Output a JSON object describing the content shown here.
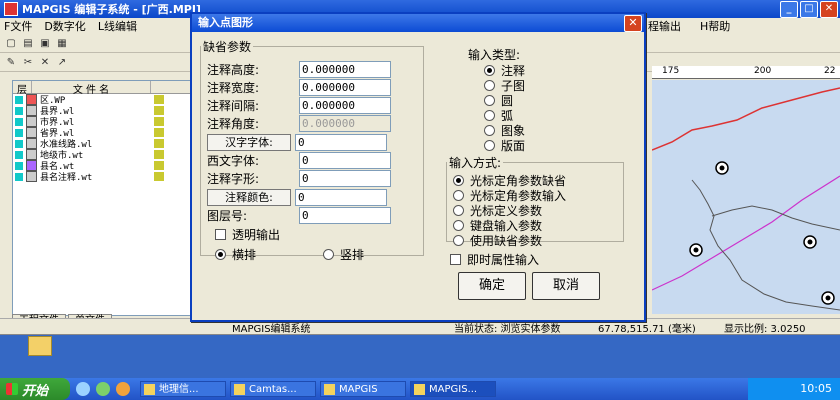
{
  "app": {
    "title": "MAPGIS 编辑子系统 - [广西.MPJ]",
    "menu": [
      "F文件",
      "D数字化",
      "L线编辑"
    ],
    "menu_right": [
      "程输出",
      "H帮助"
    ],
    "ruler": [
      "175",
      "200",
      "22"
    ],
    "layer_columns": [
      "层",
      "文 件 名"
    ],
    "layers": [
      {
        "name": "区.WP"
      },
      {
        "name": "县界.wl"
      },
      {
        "name": "市界.wl"
      },
      {
        "name": "省界.wl"
      },
      {
        "name": "水准线路.wl"
      },
      {
        "name": "地级市.wt"
      },
      {
        "name": "县名.wt"
      },
      {
        "name": "县名注释.wt"
      }
    ],
    "tabs": [
      "工程文件",
      "单文件"
    ],
    "status_app": "MAPGIS编辑系统",
    "status_state": "当前状态: 浏览实体参数",
    "status_coords": "67.78,515.71 (毫米)",
    "status_scale": "显示比例: 3.0250"
  },
  "dialog": {
    "title": "输入点图形",
    "defaults_legend": "缺省参数",
    "fields": [
      {
        "label": "注释高度:",
        "value": "0.000000"
      },
      {
        "label": "注释宽度:",
        "value": "0.000000"
      },
      {
        "label": "注释间隔:",
        "value": "0.000000"
      },
      {
        "label": "注释角度:",
        "value": "0.000000"
      }
    ],
    "font_cn_btn": "汉字字体:",
    "font_cn_value": "0",
    "font_west_label": "西文字体:",
    "font_west_value": "0",
    "shape_label": "注释字形:",
    "shape_value": "0",
    "color_btn": "注释颜色:",
    "color_value": "0",
    "layer_label": "图层号:",
    "layer_value": "0",
    "transparent_label": "透明输出",
    "orient_h": "横排",
    "orient_v": "竖排",
    "input_type_legend": "输入类型:",
    "input_types": [
      "注释",
      "子图",
      "圆",
      "弧",
      "图象",
      "版面"
    ],
    "input_mode_legend": "输入方式:",
    "input_modes": [
      "光标定角参数缺省",
      "光标定角参数输入",
      "光标定义参数",
      "键盘输入参数",
      "使用缺省参数"
    ],
    "instant_attr_label": "即时属性输入",
    "ok": "确定",
    "cancel": "取消"
  },
  "taskbar": {
    "start": "开始",
    "tasks": [
      "地理信...",
      "Camtas...",
      "MAPGIS",
      "MAPGIS..."
    ],
    "clock": "10:05"
  }
}
